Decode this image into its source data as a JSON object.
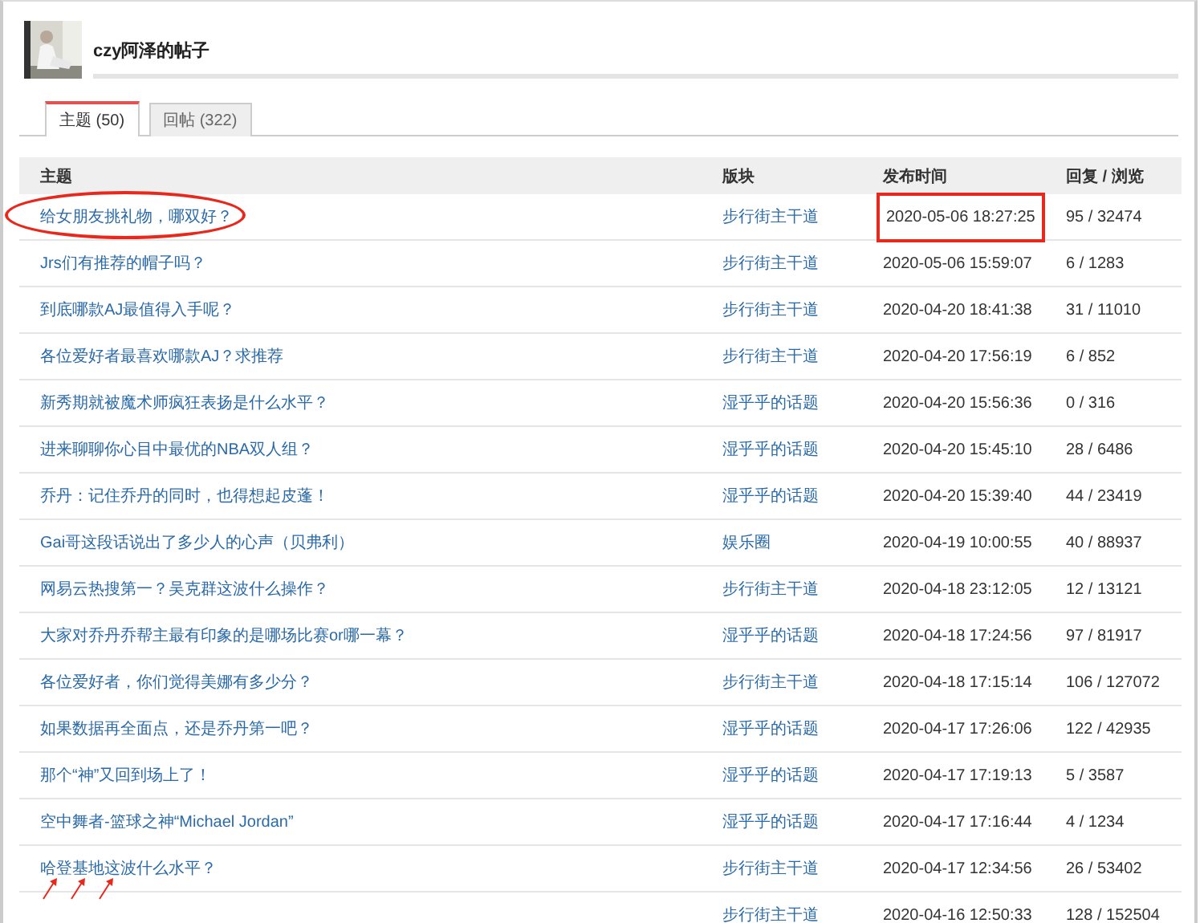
{
  "header": {
    "title": "czy阿泽的帖子"
  },
  "tabs": [
    {
      "label": "主题 (50)",
      "selected": true
    },
    {
      "label": "回帖 (322)",
      "selected": false
    }
  ],
  "table": {
    "columns": [
      "主题",
      "版块",
      "发布时间",
      "回复 / 浏览"
    ],
    "rows": [
      {
        "title": "给女朋友挑礼物，哪双好？",
        "forum": "步行街主干道",
        "time": "2020-05-06 18:27:25",
        "stats": "95 / 32474",
        "circled": true,
        "boxed": true
      },
      {
        "title": "Jrs们有推荐的帽子吗？",
        "forum": "步行街主干道",
        "time": "2020-05-06 15:59:07",
        "stats": "6 / 1283"
      },
      {
        "title": "到底哪款AJ最值得入手呢？",
        "forum": "步行街主干道",
        "time": "2020-04-20 18:41:38",
        "stats": "31 / 11010"
      },
      {
        "title": "各位爱好者最喜欢哪款AJ？求推荐",
        "forum": "步行街主干道",
        "time": "2020-04-20 17:56:19",
        "stats": "6 / 852"
      },
      {
        "title": "新秀期就被魔术师疯狂表扬是什么水平？",
        "forum": "湿乎乎的话题",
        "time": "2020-04-20 15:56:36",
        "stats": "0 / 316"
      },
      {
        "title": "进来聊聊你心目中最优的NBA双人组？",
        "forum": "湿乎乎的话题",
        "time": "2020-04-20 15:45:10",
        "stats": "28 / 6486"
      },
      {
        "title": "乔丹：记住乔丹的同时，也得想起皮蓬！",
        "forum": "湿乎乎的话题",
        "time": "2020-04-20 15:39:40",
        "stats": "44 / 23419"
      },
      {
        "title": "Gai哥这段话说出了多少人的心声（贝弗利）",
        "forum": "娱乐圈",
        "time": "2020-04-19 10:00:55",
        "stats": "40 / 88937"
      },
      {
        "title": "网易云热搜第一？吴克群这波什么操作？",
        "forum": "步行街主干道",
        "time": "2020-04-18 23:12:05",
        "stats": "12 / 13121"
      },
      {
        "title": "大家对乔丹乔帮主最有印象的是哪场比赛or哪一幕？",
        "forum": "湿乎乎的话题",
        "time": "2020-04-18 17:24:56",
        "stats": "97 / 81917"
      },
      {
        "title": "各位爱好者，你们觉得美娜有多少分？",
        "forum": "步行街主干道",
        "time": "2020-04-18 17:15:14",
        "stats": "106 / 127072"
      },
      {
        "title": "如果数据再全面点，还是乔丹第一吧？",
        "forum": "湿乎乎的话题",
        "time": "2020-04-17 17:26:06",
        "stats": "122 / 42935"
      },
      {
        "title": "那个“神”又回到场上了！",
        "forum": "湿乎乎的话题",
        "time": "2020-04-17 17:19:13",
        "stats": "5 / 3587"
      },
      {
        "title": "空中舞者-篮球之神“Michael Jordan”",
        "forum": "湿乎乎的话题",
        "time": "2020-04-17 17:16:44",
        "stats": "4 / 1234"
      },
      {
        "title": "哈登基地这波什么水平？",
        "forum": "步行街主干道",
        "time": "2020-04-17 12:34:56",
        "stats": "26 / 53402",
        "arrows": true
      },
      {
        "forum": "步行街主干道",
        "time": "2020-04-16 12:50:33",
        "stats": "128 / 152504"
      }
    ]
  }
}
